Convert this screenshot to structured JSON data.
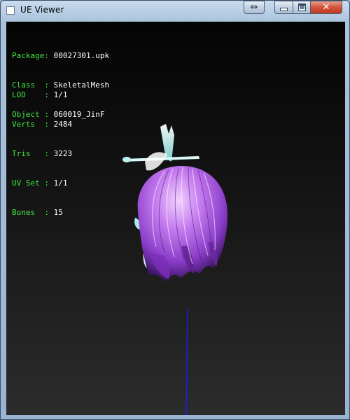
{
  "window": {
    "title": "UE Viewer",
    "controls": {
      "extra_glyph": "⇔",
      "close_glyph": "✕"
    }
  },
  "info": {
    "package": {
      "label": "Package: ",
      "value": "00027301.upk"
    },
    "class": {
      "label": "Class  : ",
      "value": "SkeletalMesh"
    },
    "object": {
      "label": "Object : ",
      "value": "060019_JinF"
    },
    "lod": {
      "label": "LOD    : ",
      "value": "1/1"
    },
    "verts": {
      "label": "Verts  : ",
      "value": "2484"
    },
    "tris": {
      "label": "Tris   : ",
      "value": "3223"
    },
    "uvset": {
      "label": "UV Set : ",
      "value": "1/1"
    },
    "bones": {
      "label": "Bones  : ",
      "value": "15"
    }
  },
  "colors": {
    "label": "#3fe63f",
    "value": "#ffffff",
    "hair_light": "#e8b8ff",
    "hair_mid": "#b060e6",
    "hair_dark": "#4a1a72",
    "bones": "#c8f4f4",
    "axis": "#1a1aff"
  }
}
